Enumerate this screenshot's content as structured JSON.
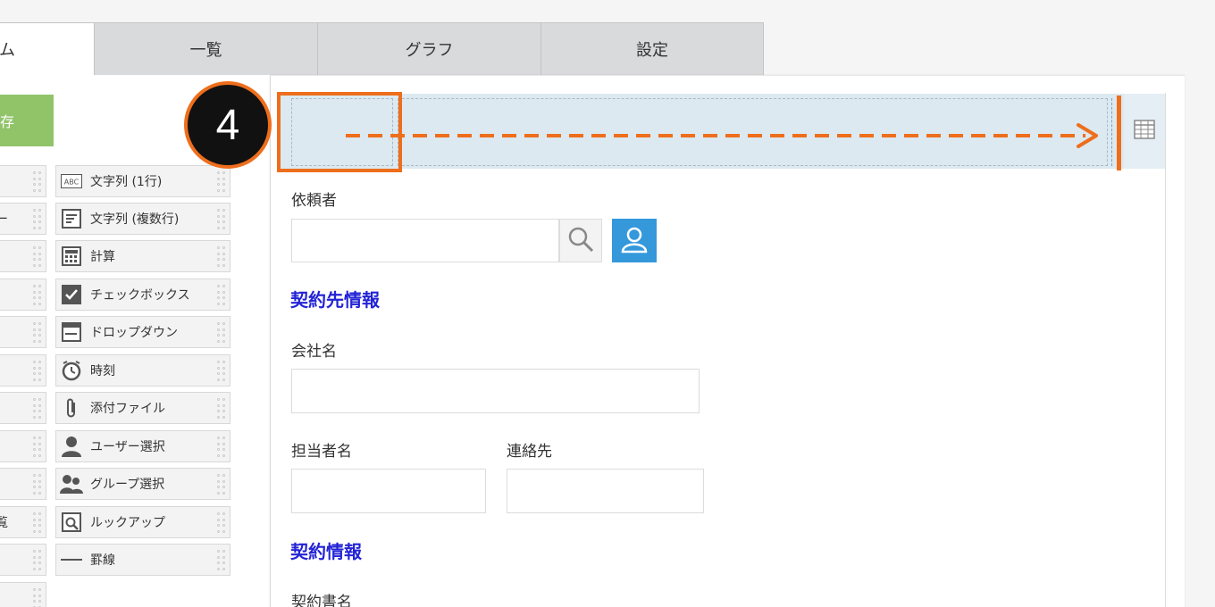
{
  "tabs": [
    {
      "label": "ム",
      "active": true
    },
    {
      "label": "一覧",
      "active": false
    },
    {
      "label": "グラフ",
      "active": false
    },
    {
      "label": "設定",
      "active": false
    }
  ],
  "save_button": {
    "label": "存"
  },
  "palette": {
    "left_partials": [
      "ー",
      "覧"
    ],
    "items": [
      {
        "label": "文字列 (1行)",
        "icon": "text-single-line-icon"
      },
      {
        "label": "文字列 (複数行)",
        "icon": "text-multi-line-icon"
      },
      {
        "label": "計算",
        "icon": "calculator-icon"
      },
      {
        "label": "チェックボックス",
        "icon": "checkbox-icon"
      },
      {
        "label": "ドロップダウン",
        "icon": "dropdown-icon"
      },
      {
        "label": "時刻",
        "icon": "clock-icon"
      },
      {
        "label": "添付ファイル",
        "icon": "paperclip-icon"
      },
      {
        "label": "ユーザー選択",
        "icon": "user-icon"
      },
      {
        "label": "グループ選択",
        "icon": "group-icon"
      },
      {
        "label": "ルックアップ",
        "icon": "lookup-icon"
      },
      {
        "label": "罫線",
        "icon": "line-icon"
      }
    ]
  },
  "step_badge": "4",
  "form": {
    "requester_label": "依頼者",
    "section1": "契約先情報",
    "company_label": "会社名",
    "contact_person_label": "担当者名",
    "contact_info_label": "連絡先",
    "section2": "契約情報",
    "contract_name_label": "契約書名"
  },
  "colors": {
    "accent_orange": "#ee6e1c",
    "save_green": "#91c469",
    "section_blue": "#2323d6",
    "user_button_blue": "#3498db"
  }
}
